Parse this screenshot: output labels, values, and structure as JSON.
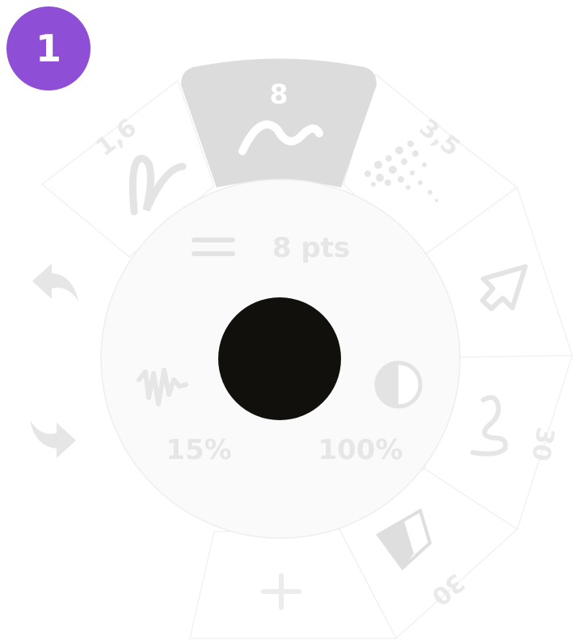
{
  "step_badge": {
    "label": "1",
    "color": "#8e4fd6"
  },
  "brush_wheel": {
    "active_brush": {
      "size": "8",
      "icon": "wave-brush-icon"
    },
    "brushes": [
      {
        "size": "1,6",
        "icon": "squiggle-pen-icon"
      },
      {
        "size": "3,5",
        "icon": "spray-brush-icon"
      },
      {
        "size": "30",
        "icon": "curve-brush-icon"
      },
      {
        "size": "30",
        "icon": "eraser-icon"
      }
    ],
    "select_tool": {
      "icon": "arrow-pointer-icon"
    },
    "add_button": {
      "icon": "plus-icon"
    },
    "undo_icon": "undo-arrow-icon",
    "redo_icon": "redo-arrow-icon"
  },
  "settings_hub": {
    "size_label": "8 pts",
    "smoothing_label": "15%",
    "opacity_label": "100%",
    "current_color": "#12100d"
  }
}
